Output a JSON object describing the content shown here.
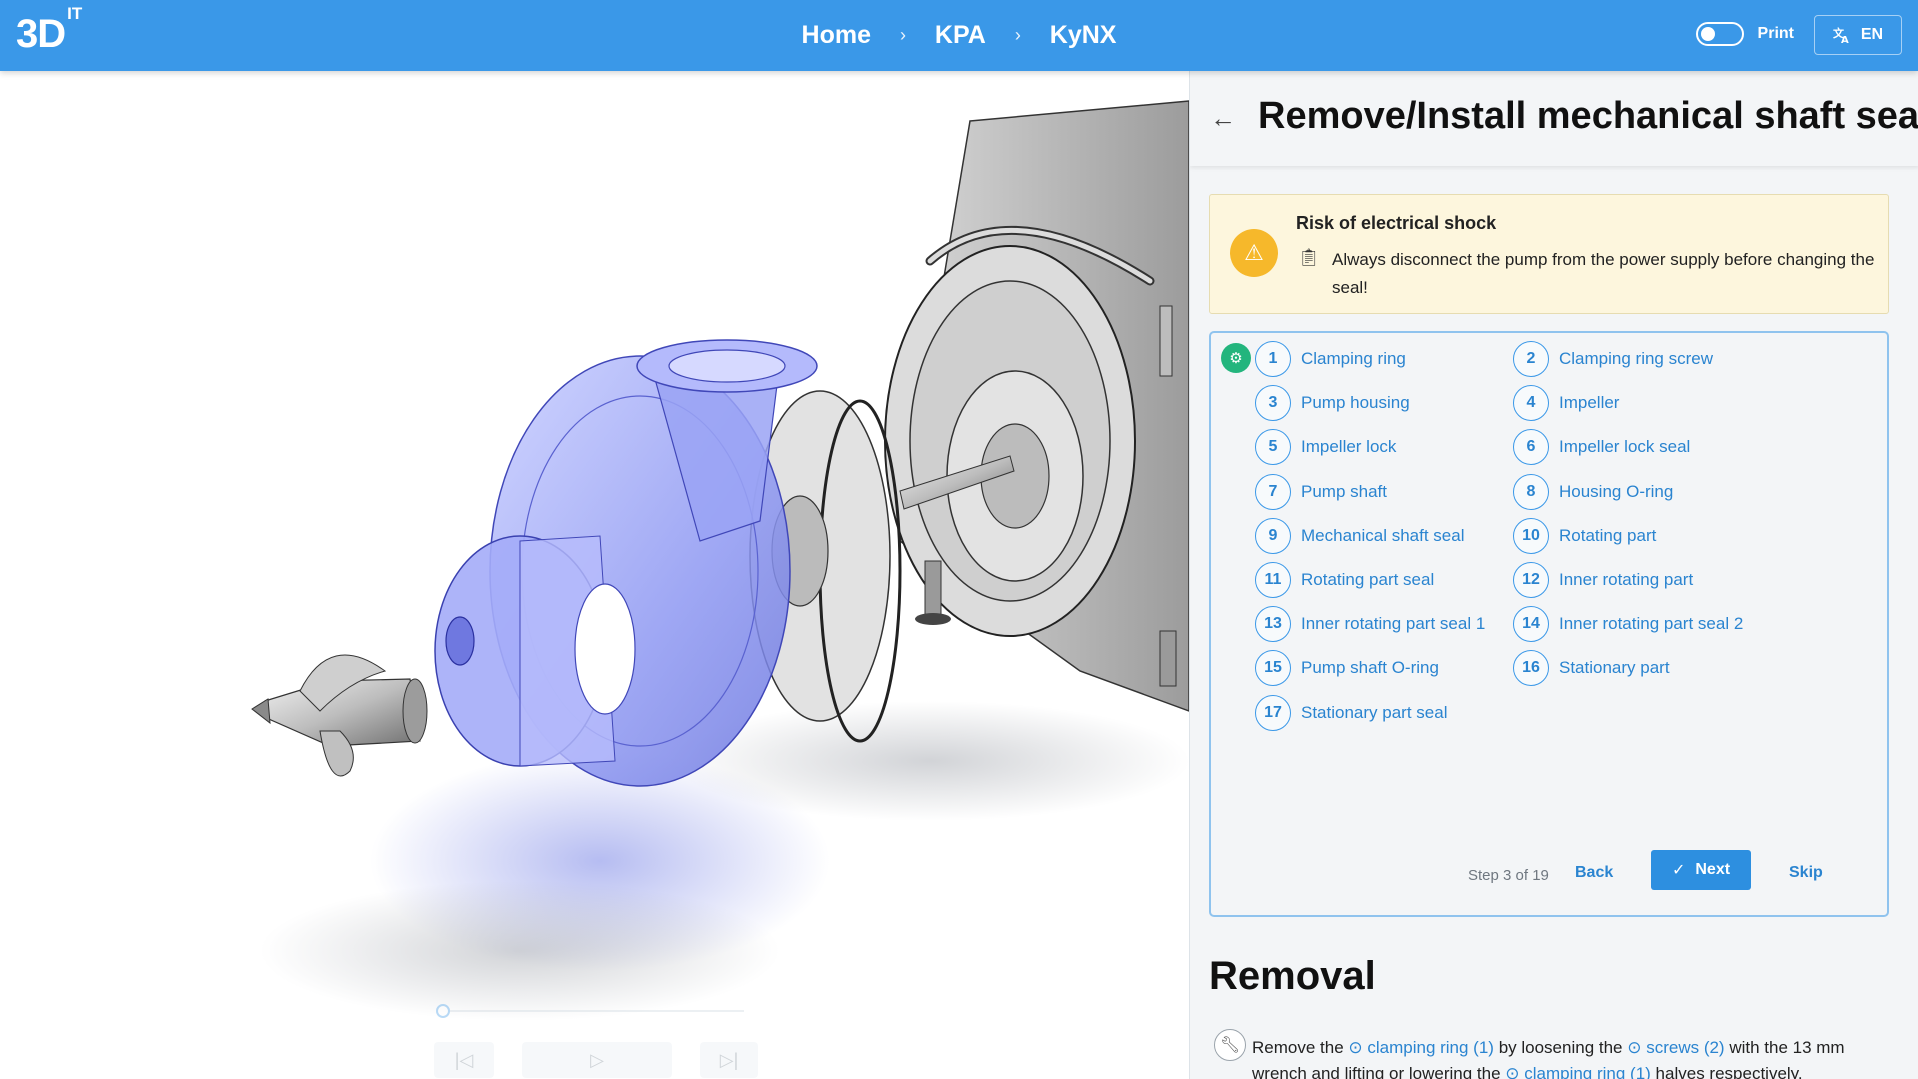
{
  "header": {
    "logo": "3D",
    "logo_sup": "IT",
    "breadcrumbs": [
      "Home",
      "KPA",
      "KyNX"
    ],
    "breadcrumb_separator": "›",
    "print_label": "Print",
    "print_toggle_on": false,
    "language": "EN"
  },
  "panel": {
    "title": "Remove/Install mechanical shaft seal",
    "warning": {
      "title": "Risk of electrical shock",
      "text": "Always disconnect the pump from the power supply before changing the seal!"
    },
    "parts": [
      {
        "num": "1",
        "label": "Clamping ring"
      },
      {
        "num": "2",
        "label": "Clamping ring screw"
      },
      {
        "num": "3",
        "label": "Pump housing"
      },
      {
        "num": "4",
        "label": "Impeller"
      },
      {
        "num": "5",
        "label": "Impeller lock"
      },
      {
        "num": "6",
        "label": "Impeller lock seal"
      },
      {
        "num": "7",
        "label": "Pump shaft"
      },
      {
        "num": "8",
        "label": "Housing O-ring"
      },
      {
        "num": "9",
        "label": "Mechanical shaft seal"
      },
      {
        "num": "10",
        "label": "Rotating part"
      },
      {
        "num": "11",
        "label": "Rotating part seal"
      },
      {
        "num": "12",
        "label": "Inner rotating part"
      },
      {
        "num": "13",
        "label": "Inner rotating part seal 1"
      },
      {
        "num": "14",
        "label": "Inner rotating part seal 2"
      },
      {
        "num": "15",
        "label": "Pump shaft O-ring"
      },
      {
        "num": "16",
        "label": "Stationary part"
      },
      {
        "num": "17",
        "label": "Stationary part seal"
      }
    ],
    "step_info": "Step 3 of 19",
    "back_label": "Back",
    "next_label": "Next",
    "skip_label": "Skip",
    "section_title": "Removal",
    "removal": {
      "t1": "Remove the ",
      "l1": "clamping ring (1)",
      "t2": " by loosening the ",
      "l2": "screws (2)",
      "t3": " with the 13 mm wrench and lifting or lowering the ",
      "l3": "clamping ring (1)",
      "t4": " halves respectively."
    }
  },
  "colors": {
    "header_bg": "#3a98e8",
    "accent": "#2d8fe0",
    "link": "#2a84d0",
    "warning_bg": "#fdf6dd",
    "warning_icon": "#f6b82b",
    "success": "#23b57d"
  }
}
